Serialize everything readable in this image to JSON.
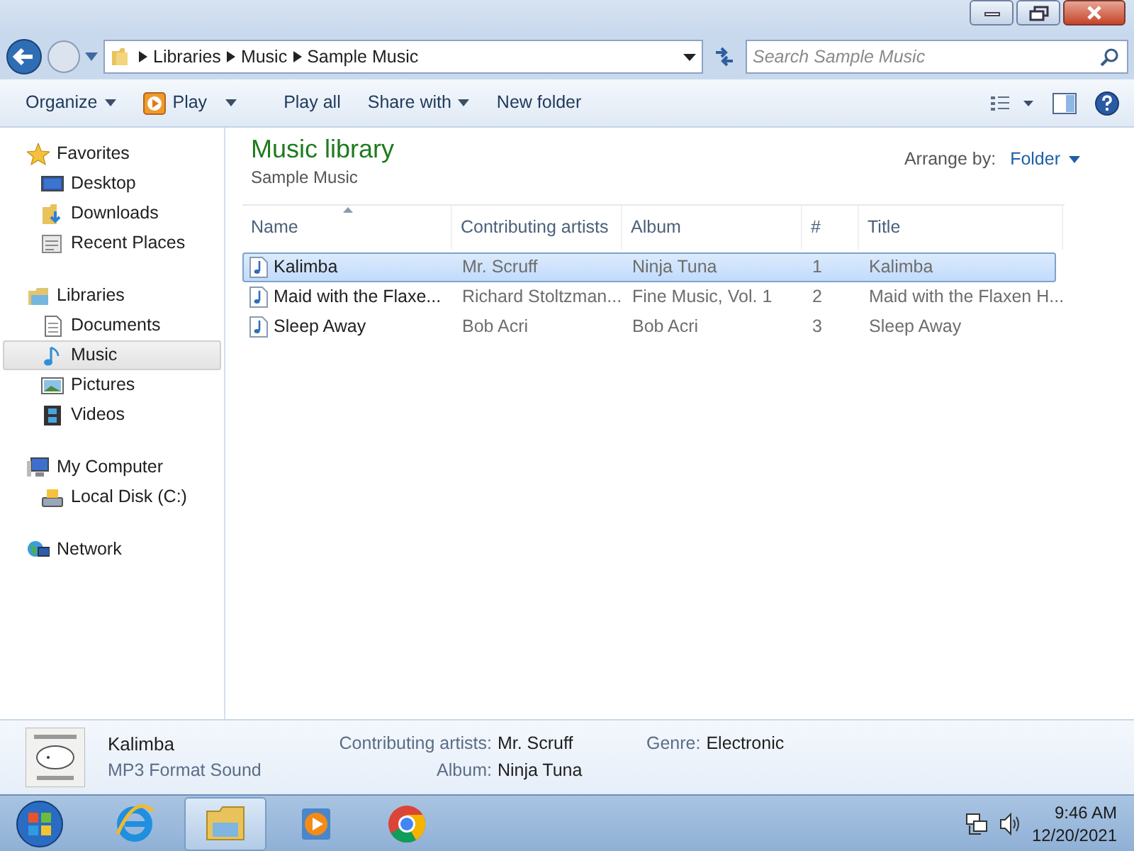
{
  "address": {
    "crumbs": [
      "Libraries",
      "Music",
      "Sample Music"
    ],
    "search_placeholder": "Search Sample Music"
  },
  "toolbar": [
    {
      "label": "Organize",
      "kind": "menu"
    },
    {
      "label": "Play",
      "kind": "play"
    },
    {
      "label": "Play all",
      "kind": "plain"
    },
    {
      "label": "Share with",
      "kind": "menu"
    },
    {
      "label": "New folder",
      "kind": "plain"
    }
  ],
  "sidebar": [
    {
      "label": "Favorites",
      "kind": "star",
      "children": [
        {
          "label": "Desktop",
          "kind": "desktop",
          "selected": false
        },
        {
          "label": "Downloads",
          "kind": "downloads",
          "selected": false
        },
        {
          "label": "Recent Places",
          "kind": "recent",
          "selected": false
        }
      ]
    },
    {
      "label": "Libraries",
      "kind": "library",
      "children": [
        {
          "label": "Documents",
          "kind": "document",
          "selected": false
        },
        {
          "label": "Music",
          "kind": "music",
          "selected": true
        },
        {
          "label": "Pictures",
          "kind": "pictures",
          "selected": false
        },
        {
          "label": "Videos",
          "kind": "videos",
          "selected": false
        }
      ]
    },
    {
      "label": "My Computer",
      "kind": "computer",
      "children": [
        {
          "label": "Local Disk (C:)",
          "kind": "disk",
          "selected": false
        }
      ]
    },
    {
      "label": "Network",
      "kind": "network"
    }
  ],
  "library": {
    "title": "Music library",
    "subtitle": "Sample Music",
    "arrange_label": "Arrange by:",
    "arrange_value": "Folder"
  },
  "table": {
    "columns": [
      {
        "label": "Name",
        "sorted": true
      },
      {
        "label": "Contributing artists",
        "sorted": false
      },
      {
        "label": "Album",
        "sorted": false
      },
      {
        "label": "#",
        "sorted": false
      },
      {
        "label": "Title",
        "sorted": false
      }
    ],
    "rows": [
      {
        "cells": [
          "Kalimba",
          "Mr. Scruff",
          "Ninja Tuna",
          "1",
          "Kalimba"
        ],
        "selected": true
      },
      {
        "cells": [
          "Maid with the Flaxe...",
          "Richard Stoltzman...",
          "Fine Music, Vol. 1",
          "2",
          "Maid with the Flaxen H..."
        ],
        "selected": false
      },
      {
        "cells": [
          "Sleep Away",
          "Bob Acri",
          "Bob Acri",
          "3",
          "Sleep Away"
        ],
        "selected": false
      }
    ]
  },
  "details": {
    "name": "Kalimba",
    "type": "MP3 Format Sound",
    "fields": [
      {
        "label": "Contributing artists:",
        "value": "Mr. Scruff"
      },
      {
        "label": "Album:",
        "value": "Ninja Tuna"
      },
      {
        "label": "Genre:",
        "value": "Electronic"
      }
    ]
  },
  "taskbar": {
    "apps": [
      {
        "kind": "browser",
        "active": false
      },
      {
        "kind": "explorer",
        "active": true
      },
      {
        "kind": "player",
        "active": false
      },
      {
        "kind": "chrome",
        "active": false
      }
    ],
    "time": "9:46 AM",
    "date": "12/20/2021"
  }
}
